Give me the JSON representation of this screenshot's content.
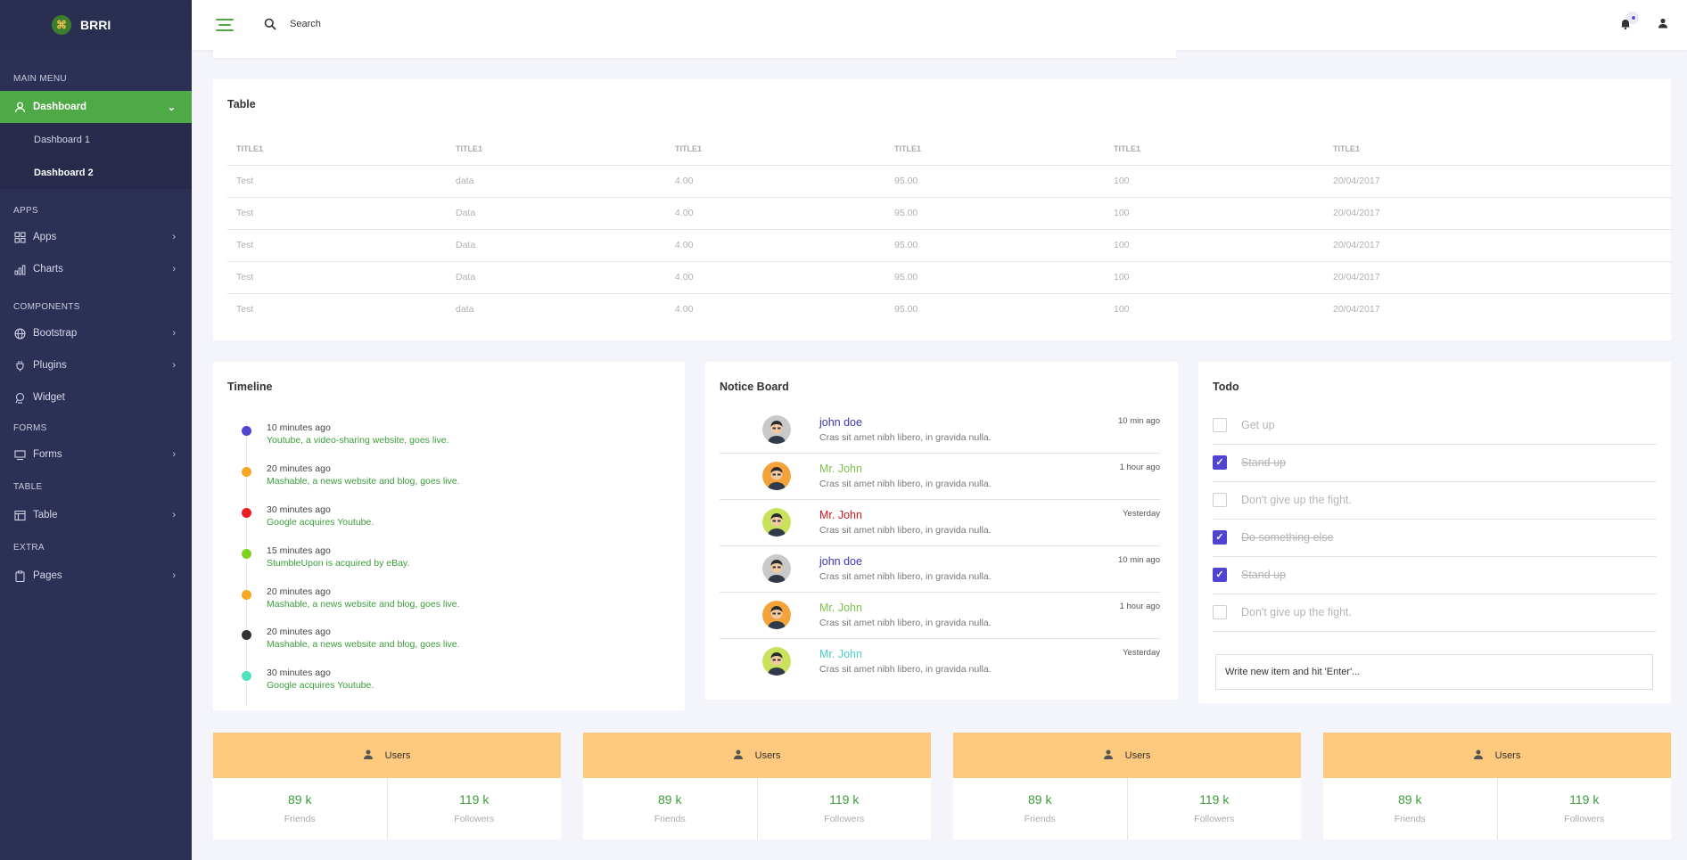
{
  "brand": {
    "name": "BRRI"
  },
  "topbar": {
    "search_placeholder": "Search"
  },
  "sidebar": {
    "sections": {
      "main": "MAIN MENU",
      "apps": "APPS",
      "components": "COMPONENTS",
      "forms": "FORMS",
      "table": "TABLE",
      "extra": "EXTRA"
    },
    "dashboard": "Dashboard",
    "dashboard1": "Dashboard 1",
    "dashboard2": "Dashboard 2",
    "apps": "Apps",
    "charts": "Charts",
    "bootstrap": "Bootstrap",
    "plugins": "Plugins",
    "widget": "Widget",
    "forms": "Forms",
    "table": "Table",
    "pages": "Pages"
  },
  "table_card": {
    "title": "Table",
    "headers": [
      "TITLE1",
      "TITLE1",
      "TITLE1",
      "TITLE1",
      "TITLE1",
      "TITLE1"
    ],
    "rows": [
      [
        "Test",
        "data",
        "4.00",
        "95.00",
        "100",
        "20/04/2017"
      ],
      [
        "Test",
        "Data",
        "4.00",
        "95.00",
        "100",
        "20/04/2017"
      ],
      [
        "Test",
        "Data",
        "4.00",
        "95.00",
        "100",
        "20/04/2017"
      ],
      [
        "Test",
        "Data",
        "4.00",
        "95.00",
        "100",
        "20/04/2017"
      ],
      [
        "Test",
        "data",
        "4.00",
        "95.00",
        "100",
        "20/04/2017"
      ]
    ]
  },
  "timeline": {
    "title": "Timeline",
    "items": [
      {
        "time": "10 minutes ago",
        "text": "Youtube, a video-sharing website, goes live.",
        "color": "#5144d3"
      },
      {
        "time": "20 minutes ago",
        "text": "Mashable, a news website and blog, goes live.",
        "color": "#f5a623"
      },
      {
        "time": "30 minutes ago",
        "text": "Google acquires Youtube.",
        "color": "#ee1c25"
      },
      {
        "time": "15 minutes ago",
        "text": "StumbleUpon is acquired by eBay.",
        "color": "#7ed321"
      },
      {
        "time": "20 minutes ago",
        "text": "Mashable, a news website and blog, goes live.",
        "color": "#f5a623"
      },
      {
        "time": "20 minutes ago",
        "text": "Mashable, a news website and blog, goes live.",
        "color": "#333333"
      },
      {
        "time": "30 minutes ago",
        "text": "Google acquires Youtube.",
        "color": "#50e3c2"
      }
    ]
  },
  "notice": {
    "title": "Notice Board",
    "items": [
      {
        "name": "john doe",
        "msg": "Cras sit amet nibh libero, in gravida nulla.",
        "time": "10 min ago",
        "color": "#3a36b3",
        "avatar_bg": "#c9c9c9"
      },
      {
        "name": "Mr. John",
        "msg": "Cras sit amet nibh libero, in gravida nulla.",
        "time": "1 hour ago",
        "color": "#7cc04b",
        "avatar_bg": "#f4a23a"
      },
      {
        "name": "Mr. John",
        "msg": "Cras sit amet nibh libero, in gravida nulla.",
        "time": "Yesterday",
        "color": "#d0161e",
        "avatar_bg": "#c9e25b"
      },
      {
        "name": "john doe",
        "msg": "Cras sit amet nibh libero, in gravida nulla.",
        "time": "10 min ago",
        "color": "#3a36b3",
        "avatar_bg": "#c9c9c9"
      },
      {
        "name": "Mr. John",
        "msg": "Cras sit amet nibh libero, in gravida nulla.",
        "time": "1 hour ago",
        "color": "#7cc04b",
        "avatar_bg": "#f4a23a"
      },
      {
        "name": "Mr. John",
        "msg": "Cras sit amet nibh libero, in gravida nulla.",
        "time": "Yesterday",
        "color": "#4ecdc4",
        "avatar_bg": "#c9e25b"
      }
    ]
  },
  "todo": {
    "title": "Todo",
    "items": [
      {
        "label": "Get up",
        "done": false
      },
      {
        "label": "Stand up",
        "done": true
      },
      {
        "label": "Don't give up the fight.",
        "done": false
      },
      {
        "label": "Do something else",
        "done": true
      },
      {
        "label": "Stand up",
        "done": true
      },
      {
        "label": "Don't give up the fight.",
        "done": false
      }
    ],
    "input_placeholder": "Write new item and hit 'Enter'..."
  },
  "stats": [
    {
      "title": "Users",
      "friends_value": "89 k",
      "friends_label": "Friends",
      "followers_value": "119 k",
      "followers_label": "Followers"
    },
    {
      "title": "Users",
      "friends_value": "89 k",
      "friends_label": "Friends",
      "followers_value": "119 k",
      "followers_label": "Followers"
    },
    {
      "title": "Users",
      "friends_value": "89 k",
      "friends_label": "Friends",
      "followers_value": "119 k",
      "followers_label": "Followers"
    },
    {
      "title": "Users",
      "friends_value": "89 k",
      "friends_label": "Friends",
      "followers_value": "119 k",
      "followers_label": "Followers"
    }
  ],
  "colors": {
    "accent": "#4eaa47",
    "sidebar": "#2c3055",
    "stat_header": "#fdc97e",
    "checkbox": "#5144d3"
  }
}
